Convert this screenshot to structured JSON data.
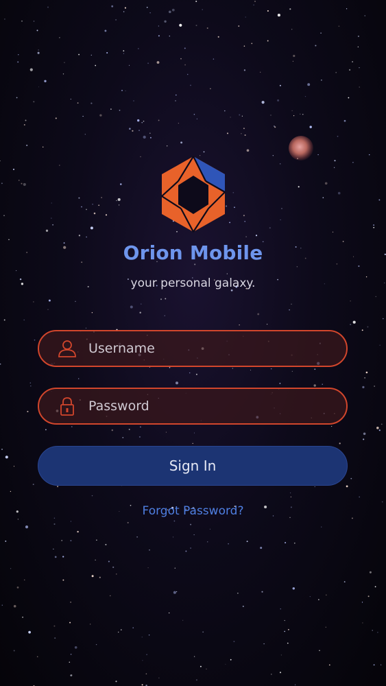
{
  "app": {
    "title": "Orion Mobile",
    "tagline": "your personal galaxy."
  },
  "form": {
    "username_placeholder": "Username",
    "password_placeholder": "Password",
    "signin_label": "Sign In",
    "forgot_label": "Forgot Password?"
  },
  "icons": {
    "logo": "orion-aperture-logo",
    "username": "user-icon",
    "password": "lock-icon"
  },
  "colors": {
    "accent_orange": "#e8622a",
    "accent_blue": "#2f55b8",
    "title_blue": "#6e95ec",
    "field_border": "#d2462c",
    "button_bg": "#1c3473",
    "link_blue": "#4f7fe2"
  }
}
